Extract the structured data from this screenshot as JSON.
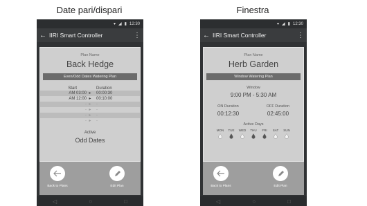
{
  "captions": {
    "left": "Date pari/dispari",
    "right": "Finestra"
  },
  "status": {
    "time": "12:30"
  },
  "app": {
    "title": "IIRI Smart Controller"
  },
  "left_phone": {
    "plan_label": "Plan Name",
    "plan_name": "Back Hedge",
    "banner": "Even/Odd Dates Watering Plan",
    "start_header": "Start",
    "duration_header": "Duration",
    "rows": [
      {
        "start": "AM  03:00",
        "mark": "▸",
        "duration": "00:00:30"
      },
      {
        "start": "AM  12:00",
        "mark": "▸",
        "duration": "00:10:00"
      },
      {
        "start": "-",
        "mark": "▸",
        "duration": "-"
      },
      {
        "start": "-",
        "mark": "▸",
        "duration": "-"
      },
      {
        "start": "-",
        "mark": "▸",
        "duration": "-"
      },
      {
        "start": "-",
        "mark": "▸",
        "duration": "-"
      }
    ],
    "active_label": "Active",
    "active_value": "Odd Dates",
    "back_label": "Back to Plans",
    "edit_label": "Edit Plan"
  },
  "right_phone": {
    "plan_label": "Plan Name",
    "plan_name": "Herb Garden",
    "banner": "Window Watering Plan",
    "window_label": "Window",
    "window_value": "9:00 PM - 5:30 AM",
    "on_label": "ON Duration",
    "on_value": "00:12:30",
    "off_label": "OFF Duration",
    "off_value": "02:45:00",
    "active_days_label": "Active Days",
    "days": [
      {
        "label": "MON",
        "active": false
      },
      {
        "label": "TUE",
        "active": true
      },
      {
        "label": "WED",
        "active": false
      },
      {
        "label": "THU",
        "active": true
      },
      {
        "label": "FRI",
        "active": true
      },
      {
        "label": "SAT",
        "active": false
      },
      {
        "label": "SUN",
        "active": false
      }
    ],
    "back_label": "Back to Plans",
    "edit_label": "Edit Plan"
  },
  "colors": {
    "accent_button": "#ffffff",
    "drop_active": "#555555",
    "drop_inactive": "#f2f2f2"
  }
}
